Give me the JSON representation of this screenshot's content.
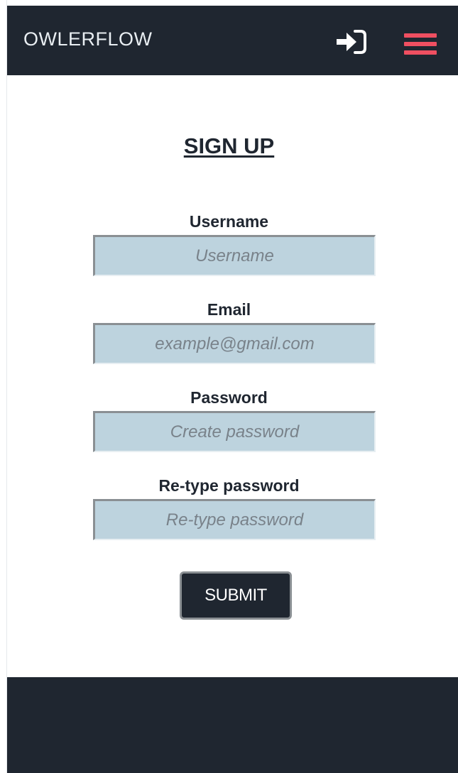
{
  "app": {
    "brand": "OWLERFLOW"
  },
  "navbar": {
    "login_icon": "sign-in-icon",
    "menu_icon": "hamburger-menu-icon",
    "accent_color": "#ef4f61",
    "background_color": "#1f2630"
  },
  "form": {
    "title": "SIGN UP",
    "username": {
      "label": "Username",
      "placeholder": "Username",
      "value": ""
    },
    "email": {
      "label": "Email",
      "placeholder": "example@gmail.com",
      "value": ""
    },
    "password": {
      "label": "Password",
      "placeholder": "Create password",
      "value": ""
    },
    "retype_password": {
      "label": "Re-type password",
      "placeholder": "Re-type password",
      "value": ""
    },
    "submit_label": "SUBMIT",
    "input_background_color": "#bdd3de"
  },
  "footer": {
    "background_color": "#1f2630"
  }
}
